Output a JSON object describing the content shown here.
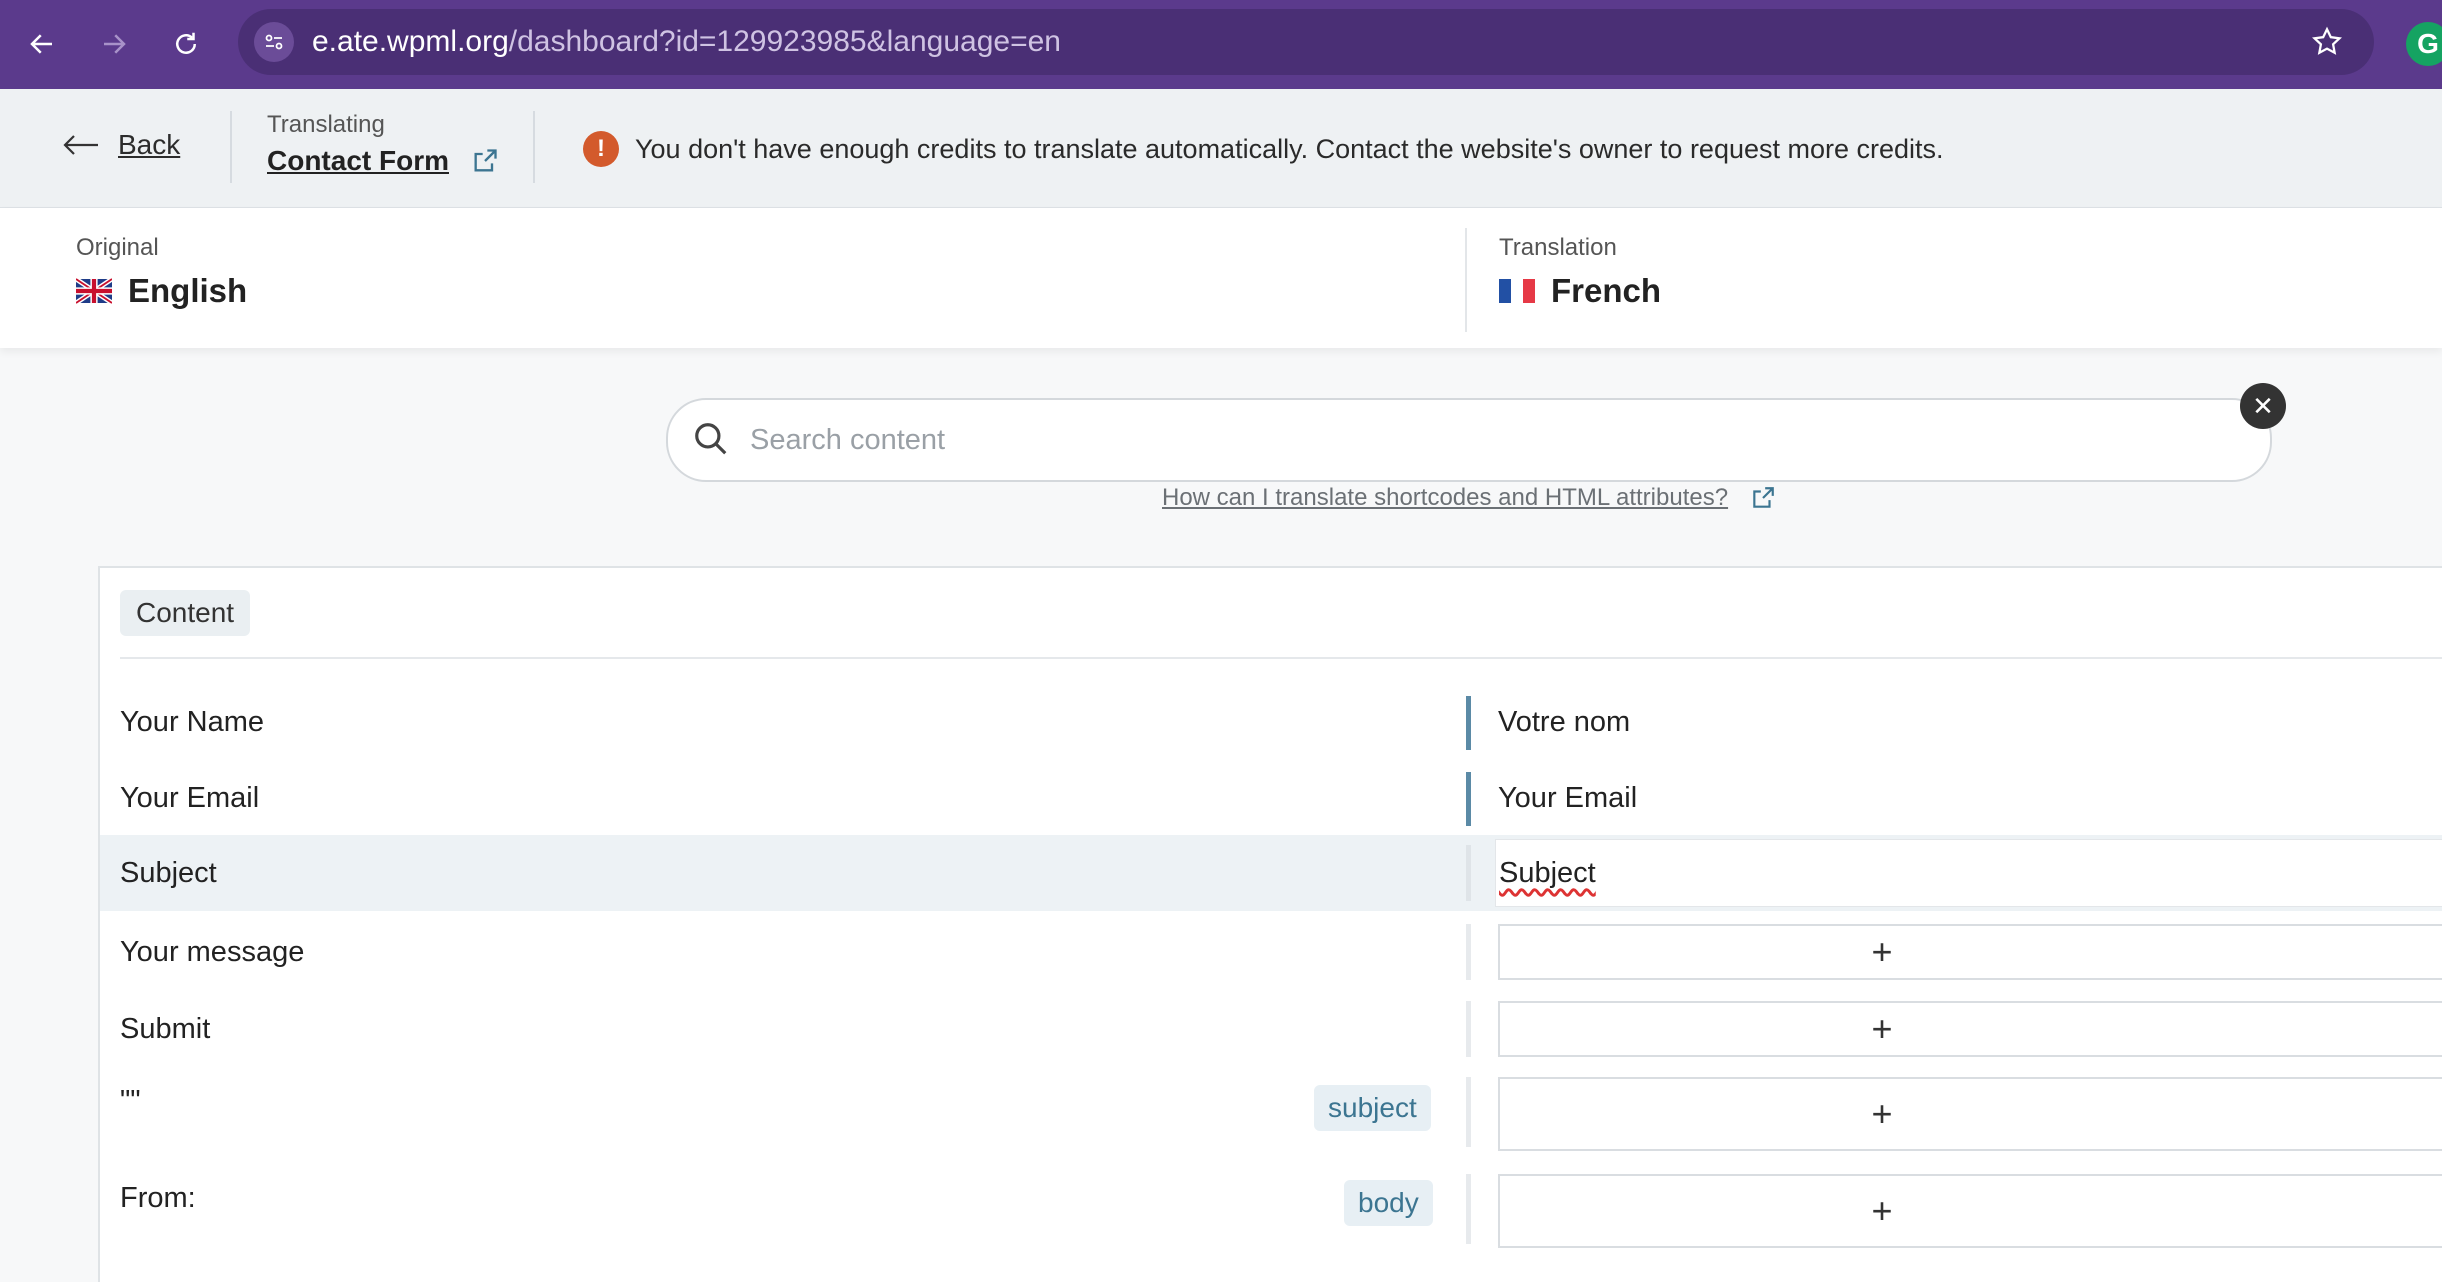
{
  "browser": {
    "url_host": "e.ate.wpml.org",
    "url_rest": "/dashboard?id=129923985&language=en",
    "extension_letter": "G"
  },
  "header": {
    "back_label": "Back",
    "translating_label": "Translating",
    "document_title": "Contact Form",
    "alert_icon": "!",
    "alert_text": "You don't have enough credits to translate automatically. Contact the website's owner to request more credits."
  },
  "languages": {
    "original_caption": "Original",
    "original_name": "English",
    "translation_caption": "Translation",
    "translation_name": "French"
  },
  "search": {
    "placeholder": "Search content",
    "clear_icon": "✕",
    "help_link": "How can I translate shortcodes and HTML attributes?"
  },
  "content": {
    "section_label": "Content",
    "rows": [
      {
        "original": "Your Name",
        "translation": "Votre nom"
      },
      {
        "original": "Your Email",
        "translation": "Your Email"
      },
      {
        "original": "Subject",
        "translation": "Subject"
      },
      {
        "original": "Your message",
        "translation": "+"
      },
      {
        "original": "Submit",
        "translation": "+"
      },
      {
        "original": "\"\"",
        "tag": "subject",
        "translation": "+"
      },
      {
        "original": "From:",
        "tag": "body",
        "translation": "+"
      }
    ]
  },
  "colors": {
    "browser_chrome": "#5b3a8c",
    "accent_bar": "#5b8aa6",
    "alert": "#d35a2c"
  }
}
